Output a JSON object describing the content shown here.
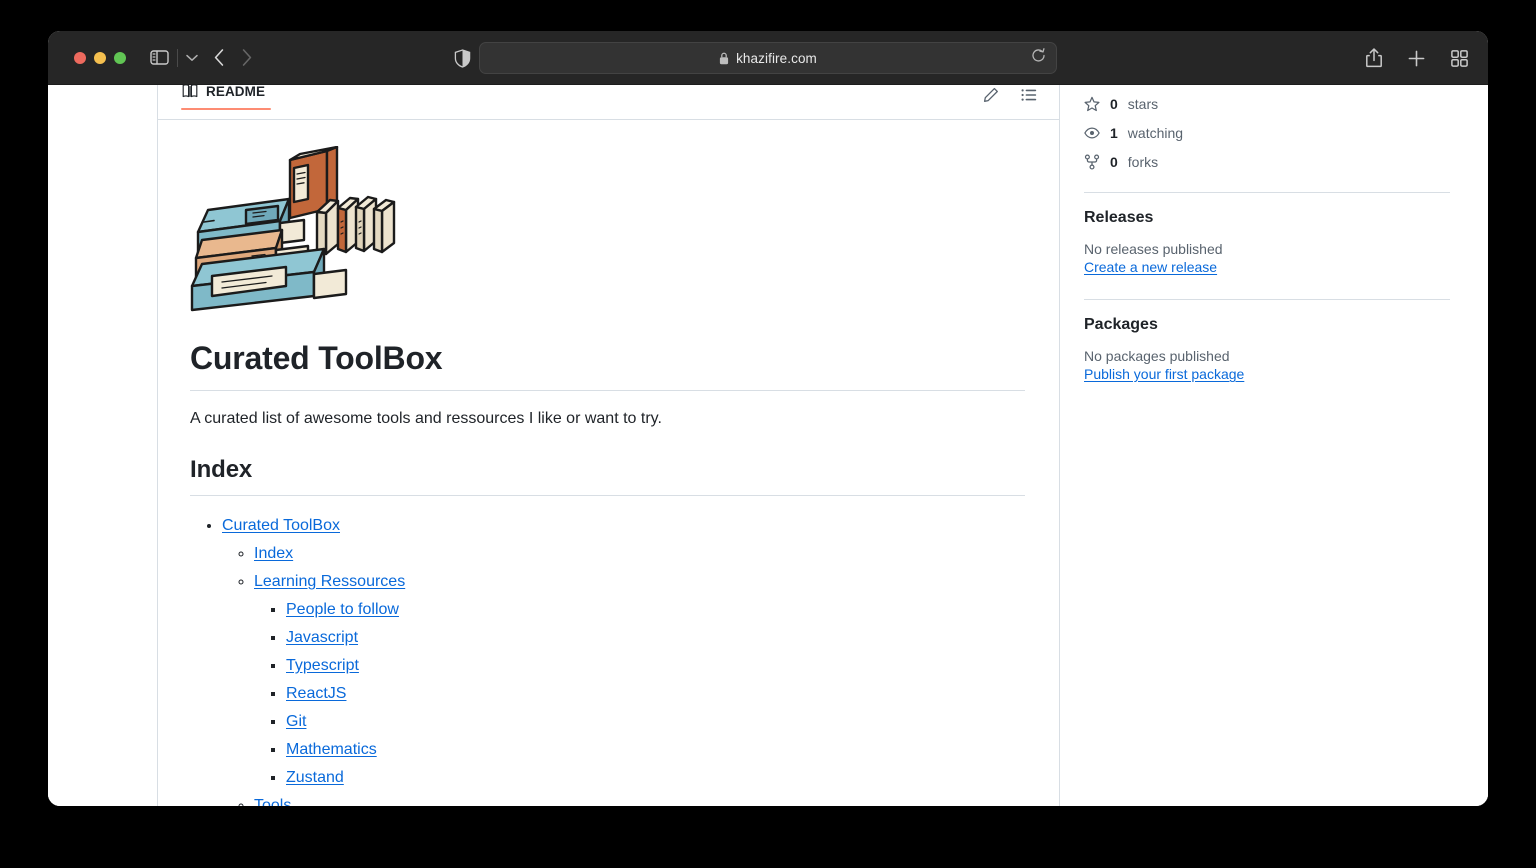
{
  "browser": {
    "traffic_lights": [
      "close",
      "minimize",
      "zoom"
    ],
    "url": "khazifire.com",
    "secure_icon": "lock-icon",
    "toolbar_icons": [
      "sidebar-toggle-icon",
      "chevron-down-icon",
      "back-arrow-icon",
      "forward-arrow-icon",
      "shield-icon",
      "reload-icon",
      "share-icon",
      "new-tab-plus-icon",
      "tab-overview-icon"
    ]
  },
  "readme": {
    "tab_label": "README",
    "tab_icon": "book-icon",
    "actions": [
      "edit-pencil-icon",
      "outline-list-icon"
    ],
    "accent_color": "#fd8c73",
    "illustration_alt": "stack-of-books-illustration",
    "title": "Curated ToolBox",
    "description": "A curated list of awesome tools and ressources I like or want to try.",
    "index_heading": "Index",
    "index": [
      {
        "label": "Curated ToolBox",
        "children": [
          {
            "label": "Index",
            "children": []
          },
          {
            "label": "Learning Ressources",
            "children": [
              {
                "label": "People to follow"
              },
              {
                "label": "Javascript"
              },
              {
                "label": "Typescript"
              },
              {
                "label": "ReactJS"
              },
              {
                "label": "Git"
              },
              {
                "label": "Mathematics"
              },
              {
                "label": "Zustand"
              }
            ]
          },
          {
            "label": "Tools",
            "children": []
          }
        ]
      }
    ]
  },
  "sidebar": {
    "stats": [
      {
        "icon": "star-icon",
        "count": "0",
        "label": "stars"
      },
      {
        "icon": "eye-icon",
        "count": "1",
        "label": "watching"
      },
      {
        "icon": "fork-icon",
        "count": "0",
        "label": "forks"
      }
    ],
    "releases": {
      "title": "Releases",
      "empty": "No releases published",
      "link": "Create a new release"
    },
    "packages": {
      "title": "Packages",
      "empty": "No packages published",
      "link": "Publish your first package"
    }
  },
  "colors": {
    "link": "#0969da",
    "text": "#1f2328",
    "muted": "#59636e",
    "border": "#d8dee4",
    "chrome": "#262626",
    "accent": "#fd8c73"
  }
}
